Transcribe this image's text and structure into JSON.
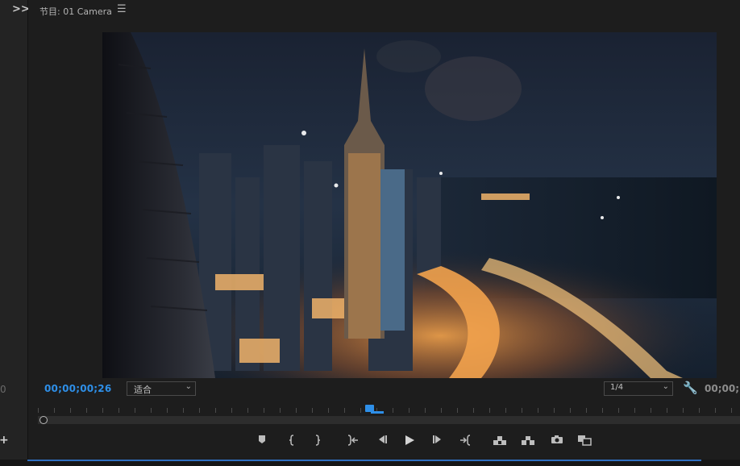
{
  "header": {
    "title": "节目: 01 Camera",
    "menu_icon": "hamburger-menu-icon"
  },
  "left": {
    "expand_icon": ">>",
    "timecode_fragment": "0",
    "add_icon": "+"
  },
  "monitor": {
    "current_time": "00;00;00;26",
    "fit": "适合",
    "resolution": "1/4",
    "end_time": "00;00;",
    "accent": "#2e8fe8"
  },
  "transport": {
    "buttons": [
      {
        "name": "add-marker-button",
        "icon": "marker-icon"
      },
      {
        "name": "mark-in-button",
        "icon": "mark-in-icon"
      },
      {
        "name": "mark-out-button",
        "icon": "mark-out-icon"
      },
      {
        "name": "go-to-in-button",
        "icon": "go-to-in-icon"
      },
      {
        "name": "step-back-button",
        "icon": "step-back-icon"
      },
      {
        "name": "play-button",
        "icon": "play-icon"
      },
      {
        "name": "step-forward-button",
        "icon": "step-forward-icon"
      },
      {
        "name": "go-to-out-button",
        "icon": "go-to-out-icon"
      },
      {
        "name": "lift-button",
        "icon": "lift-icon"
      },
      {
        "name": "extract-button",
        "icon": "extract-icon"
      },
      {
        "name": "export-frame-button",
        "icon": "camera-icon"
      },
      {
        "name": "comparison-view-button",
        "icon": "compare-icon"
      }
    ]
  }
}
